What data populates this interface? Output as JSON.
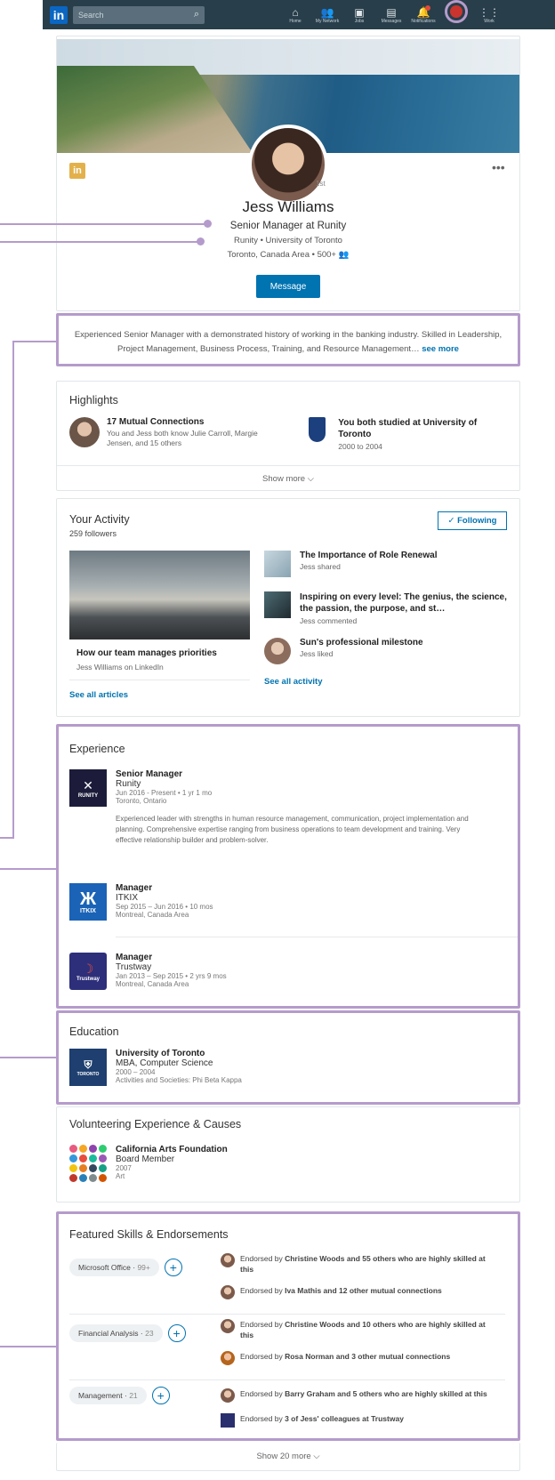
{
  "nav": {
    "logo": "in",
    "search_placeholder": "Search",
    "items": [
      {
        "label": "Home",
        "icon": "home-icon"
      },
      {
        "label": "My Network",
        "icon": "network-icon"
      },
      {
        "label": "Jobs",
        "icon": "jobs-icon"
      },
      {
        "label": "Messages",
        "icon": "messages-icon"
      },
      {
        "label": "Notifications",
        "icon": "bell-icon"
      }
    ],
    "me_label": "Me",
    "work_label": "Work"
  },
  "profile": {
    "name": "Jess Williams",
    "headline": "Senior Manager at Runity",
    "education_line": "Runity • University of Toronto",
    "location_line": "Toronto, Canada Area • 500+ 👥",
    "degree": "1st",
    "message_button": "Message"
  },
  "summary": {
    "text": "Experienced Senior Manager with a demonstrated history of working in the banking industry. Skilled in Leadership, Project Management, Business Process, Training, and Resource Management…",
    "see_more": "see more"
  },
  "highlights": {
    "title": "Highlights",
    "mutual_title": "17 Mutual Connections",
    "mutual_desc": "You and Jess both know Julie Carroll, Margie Jensen, and 15 others",
    "school_title": "You both studied at University of Toronto",
    "school_years": "2000 to 2004",
    "show_more": "Show more ⌵"
  },
  "activity": {
    "title": "Your Activity",
    "followers": "259 followers",
    "following_button": "✓ Following",
    "article_title": "How our team manages priorities",
    "article_source": "Jess Williams on LinkedIn",
    "see_all_articles": "See all articles",
    "items": [
      {
        "title": "The Importance of Role Renewal",
        "meta": "Jess shared"
      },
      {
        "title": "Inspiring on every level: The genius, the science, the passion, the purpose, and st…",
        "meta": "Jess commented"
      },
      {
        "title": "Sun's professional milestone",
        "meta": "Jess liked"
      }
    ],
    "see_all_activity": "See all activity"
  },
  "experience": {
    "title": "Experience",
    "jobs": [
      {
        "logo": "RUNITY",
        "title": "Senior Manager",
        "company": "Runity",
        "dates": "Jun 2016 - Present • 1 yr 1 mo",
        "location": "Toronto, Ontario",
        "description": "Experienced leader with strengths in human resource management, communication, project implementation and planning. Comprehensive expertise ranging from business operations to team development and training. Very effective relationship builder and problem-solver."
      },
      {
        "logo": "ITKIX",
        "title": "Manager",
        "company": "ITKIX",
        "dates": "Sep 2015 – Jun 2016 • 10 mos",
        "location": "Montreal, Canada Area",
        "description": ""
      },
      {
        "logo": "Trustway",
        "title": "Manager",
        "company": "Trustway",
        "dates": "Jan 2013 – Sep 2015 • 2 yrs 9 mos",
        "location": "Montreal, Canada Area",
        "description": ""
      }
    ]
  },
  "education": {
    "title": "Education",
    "school": "University of Toronto",
    "degree": "MBA, Computer Science",
    "years": "2000 – 2004",
    "activities": "Activities and Societies: Phi Beta Kappa",
    "logo_text": "TORONTO"
  },
  "volunteering": {
    "title": "Volunteering Experience & Causes",
    "org": "California Arts Foundation",
    "role": "Board Member",
    "year": "2007",
    "cause": "Art"
  },
  "skills": {
    "title": "Featured Skills & Endorsements",
    "items": [
      {
        "name": "Microsoft Office",
        "count": "99+",
        "e1_pre": "Endorsed by ",
        "e1_bold": "Christine Woods and 55 others who are highly skilled at this",
        "e2_pre": "Endorsed by ",
        "e2_bold": "Iva Mathis and 12 other mutual connections"
      },
      {
        "name": "Financial Analysis",
        "count": "23",
        "e1_pre": "Endorsed by ",
        "e1_bold": "Christine Woods and 10 others who are highly skilled at this",
        "e2_pre": "Endorsed by ",
        "e2_bold": "Rosa Norman and 3 other mutual connections"
      },
      {
        "name": "Management",
        "count": "21",
        "e1_pre": "Endorsed by ",
        "e1_bold": "Barry Graham and 5 others who are highly skilled at this",
        "e2_pre": "Endorsed by ",
        "e2_bold": "3 of Jess' colleagues at Trustway"
      }
    ],
    "show_more": "Show 20 more ⌵"
  }
}
